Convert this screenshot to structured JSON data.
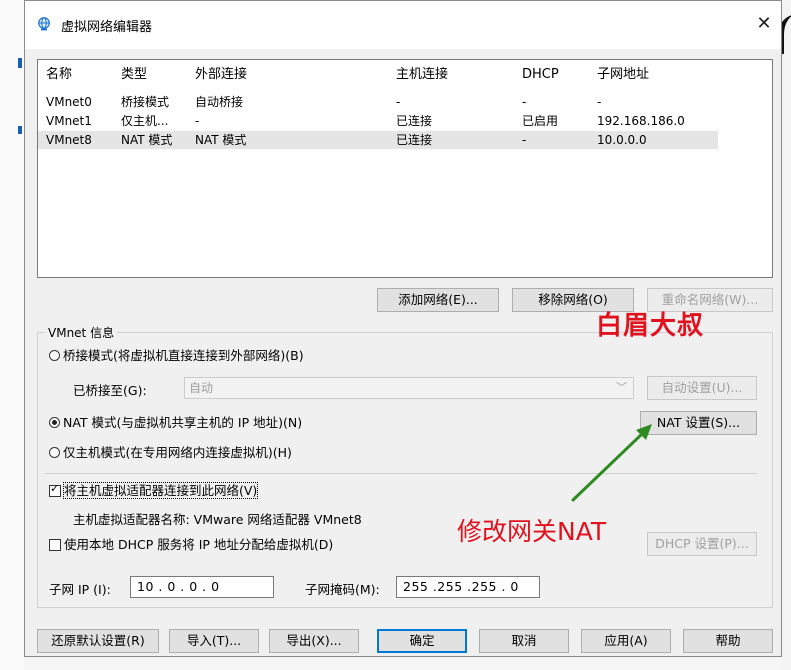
{
  "window": {
    "title": "虚拟网络编辑器",
    "close_glyph": "✕"
  },
  "table": {
    "headers": [
      "名称",
      "类型",
      "外部连接",
      "主机连接",
      "DHCP",
      "子网地址"
    ],
    "rows": [
      [
        "VMnet0",
        "桥接模式",
        "自动桥接",
        "-",
        "-",
        "-"
      ],
      [
        "VMnet1",
        "仅主机...",
        "-",
        "已连接",
        "已启用",
        "192.168.186.0"
      ],
      [
        "VMnet8",
        "NAT 模式",
        "NAT 模式",
        "已连接",
        "-",
        "10.0.0.0"
      ]
    ],
    "selected_row": 2
  },
  "list_buttons": {
    "add": "添加网络(E)...",
    "remove": "移除网络(O)",
    "rename": "重命名网络(W)..."
  },
  "vmnet_info": {
    "legend": "VMnet 信息",
    "bridge_radio": "桥接模式(将虚拟机直接连接到外部网络)(B)",
    "bridged_to_label": "已桥接至(G):",
    "bridged_to_value": "自动",
    "auto_settings_button": "自动设置(U)...",
    "nat_radio": "NAT 模式(与虚拟机共享主机的 IP 地址)(N)",
    "nat_settings_button": "NAT 设置(S)...",
    "hostonly_radio": "仅主机模式(在专用网络内连接虚拟机)(H)",
    "selected_mode": "nat",
    "connect_adapter_check": "将主机虚拟适配器连接到此网络(V)",
    "connect_adapter_checked": true,
    "adapter_name_text": "主机虚拟适配器名称: VMware 网络适配器 VMnet8",
    "dhcp_check": "使用本地 DHCP 服务将 IP 地址分配给虚拟机(D)",
    "dhcp_checked": false,
    "dhcp_settings_button": "DHCP 设置(P)...",
    "subnet_ip_label": "子网 IP (I):",
    "subnet_ip_value": "10 . 0 . 0 . 0",
    "subnet_mask_label": "子网掩码(M):",
    "subnet_mask_value": "255 .255 .255 . 0"
  },
  "footer_buttons": {
    "restore": "还原默认设置(R)",
    "import": "导入(T)...",
    "export": "导出(X)...",
    "ok": "确定",
    "cancel": "取消",
    "apply": "应用(A)",
    "help": "帮助"
  },
  "annotations": {
    "watermark": "白眉大叔",
    "note": "修改网关NAT",
    "color": "#e0121e",
    "arrow_color": "#2e8b22"
  },
  "colors": {
    "accent": "#0078d7",
    "selection": "#e5e5e5",
    "dialog_bg": "#f0f0f0"
  }
}
